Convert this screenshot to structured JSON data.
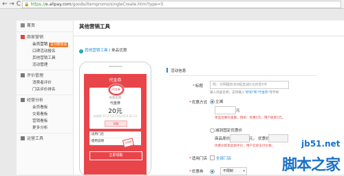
{
  "browser": {
    "back_glyph": "←",
    "forward_glyph": "→",
    "reload_glyph": "C",
    "lock_glyph": "🔒",
    "url_scheme": "https://",
    "url_host": "e.alipay.com",
    "url_path": "/goods/itempromo/singleCreate.htm?type=5"
  },
  "sidebar": {
    "home": "首页",
    "groups": [
      {
        "title": "商家营销",
        "icon_color": "#e04545",
        "items": [
          {
            "label": "会员营销",
            "badge": "支付即会员"
          },
          {
            "label": "口碑活动报名",
            "badge": ""
          },
          {
            "label": "其他营销工具",
            "badge": ""
          },
          {
            "label": "活动管理",
            "badge": ""
          }
        ]
      },
      {
        "title": "评价管理",
        "icon_color": "#777777",
        "items": [
          {
            "label": "消费者评价",
            "badge": ""
          },
          {
            "label": "门店评价排名",
            "badge": ""
          }
        ]
      },
      {
        "title": "经营分析",
        "icon_color": "#777777",
        "items": [
          {
            "label": "会员看板",
            "badge": ""
          },
          {
            "label": "交易看板",
            "badge": ""
          },
          {
            "label": "营销看板",
            "badge": ""
          },
          {
            "label": "更多分析",
            "badge": ""
          }
        ]
      },
      {
        "title": "运营工具",
        "icon_color": "#777777",
        "items": []
      }
    ]
  },
  "main": {
    "title": "其他营销工具",
    "breadcrumb": {
      "icon_glyph": "‹",
      "link": "其他营销工具",
      "sep": "/",
      "current": "单品优惠"
    }
  },
  "preview": {
    "voucher_title": "代金券",
    "seal_text": "代金券",
    "shop_name": "商家名称",
    "coupon_name": "代金券",
    "amount": "20元",
    "validity": "有效期 2015-12-19至2016-01-22",
    "card_button": "领取",
    "rows": [
      {
        "label": "适用门店",
        "arrow": "›"
      },
      {
        "label": "使用说明",
        "arrow": "›"
      }
    ],
    "stamp": "已领取",
    "claim_button": "立即领取"
  },
  "form": {
    "section": "活动信息",
    "title_label": "标题",
    "title_placeholder": "例：光明酸奶买8瓶直减5元的零5件",
    "title_hint_pre": "输入商品名称，支持输入",
    "title_hint_link": "\"折扣\"和\"代金券\"",
    "title_hint_post": "等字样",
    "offer_label": "优惠方式",
    "option_direct": "立减",
    "unit_yuan": "元",
    "direct_hint": "单品优惠的金额，例如：优惠5元，用户收到5元。",
    "option_fixed": "减到固定优惠价",
    "orig_price_label": "商品原价",
    "yuan_comma": "元，",
    "sale_price_label": "优惠价",
    "fixed_hint": "优惠价即单品到手价，用户实际支付价格。",
    "stores_label": "适用门店",
    "stores_value": "全部门店",
    "bottom_label": "优惠券",
    "bottom_value": "不限制"
  },
  "watermark": {
    "line1": "jb51.net",
    "line2": "脚本之家"
  },
  "colors": {
    "accent": "#1a8bd6",
    "voucher_red": "#e8454a",
    "badge": "#f07c2c",
    "warning": "#e24444"
  }
}
